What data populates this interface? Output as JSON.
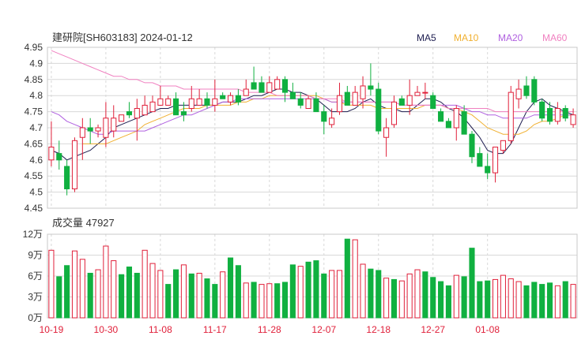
{
  "chart_data": [
    {
      "type": "candlestick",
      "title": "建研院[SH603183] 2024-01-12",
      "legend": [
        {
          "name": "MA5",
          "color": "#1e1e50"
        },
        {
          "name": "MA10",
          "color": "#f0b030"
        },
        {
          "name": "MA20",
          "color": "#b060e0"
        },
        {
          "name": "MA60",
          "color": "#f080c0"
        }
      ],
      "colors": {
        "up": "#e0203a",
        "down": "#10b040",
        "grid": "#d8d8d8"
      },
      "ylim": [
        4.45,
        4.95
      ],
      "y_ticks": [
        "4.95",
        "4.9",
        "4.85",
        "4.8",
        "4.75",
        "4.7",
        "4.65",
        "4.6",
        "4.55",
        "4.5",
        "4.45"
      ],
      "x_ticks": [
        "10-19",
        "10-30",
        "11-08",
        "11-17",
        "11-28",
        "12-07",
        "12-18",
        "12-27",
        "01-08"
      ],
      "x_tick_index": [
        0,
        7,
        14,
        21,
        28,
        35,
        42,
        49,
        56
      ],
      "candles": [
        [
          4.6,
          4.64,
          4.58,
          4.72
        ],
        [
          4.62,
          4.6,
          4.57,
          4.66
        ],
        [
          4.58,
          4.51,
          4.49,
          4.6
        ],
        [
          4.51,
          4.66,
          4.5,
          4.67
        ],
        [
          4.67,
          4.7,
          4.6,
          4.73
        ],
        [
          4.7,
          4.69,
          4.65,
          4.73
        ],
        [
          4.69,
          4.7,
          4.67,
          4.71
        ],
        [
          4.67,
          4.73,
          4.64,
          4.78
        ],
        [
          4.69,
          4.73,
          4.67,
          4.77
        ],
        [
          4.72,
          4.74,
          4.72,
          4.74
        ],
        [
          4.75,
          4.74,
          4.73,
          4.78
        ],
        [
          4.73,
          4.76,
          4.66,
          4.79
        ],
        [
          4.74,
          4.77,
          4.74,
          4.8
        ],
        [
          4.75,
          4.78,
          4.75,
          4.8
        ],
        [
          4.77,
          4.79,
          4.78,
          4.83
        ],
        [
          4.77,
          4.79,
          4.77,
          4.8
        ],
        [
          4.79,
          4.74,
          4.74,
          4.81
        ],
        [
          4.75,
          4.74,
          4.72,
          4.78
        ],
        [
          4.76,
          4.79,
          4.75,
          4.83
        ],
        [
          4.77,
          4.79,
          4.77,
          4.82
        ],
        [
          4.79,
          4.77,
          4.76,
          4.81
        ],
        [
          4.77,
          4.79,
          4.75,
          4.85
        ],
        [
          4.8,
          4.79,
          4.79,
          4.81
        ],
        [
          4.78,
          4.8,
          4.77,
          4.81
        ],
        [
          4.8,
          4.78,
          4.77,
          4.82
        ],
        [
          4.8,
          4.82,
          4.8,
          4.85
        ],
        [
          4.84,
          4.82,
          4.82,
          4.89
        ],
        [
          4.84,
          4.81,
          4.81,
          4.86
        ],
        [
          4.81,
          4.84,
          4.81,
          4.86
        ],
        [
          4.82,
          4.85,
          4.82,
          4.86
        ],
        [
          4.85,
          4.81,
          4.78,
          4.86
        ],
        [
          4.81,
          4.79,
          4.79,
          4.84
        ],
        [
          4.79,
          4.77,
          4.76,
          4.81
        ],
        [
          4.76,
          4.79,
          4.76,
          4.8
        ],
        [
          4.79,
          4.75,
          4.75,
          4.81
        ],
        [
          4.75,
          4.72,
          4.68,
          4.77
        ],
        [
          4.71,
          4.73,
          4.7,
          4.76
        ],
        [
          4.75,
          4.8,
          4.74,
          4.84
        ],
        [
          4.81,
          4.77,
          4.77,
          4.83
        ],
        [
          4.77,
          4.81,
          4.77,
          4.83
        ],
        [
          4.79,
          4.83,
          4.76,
          4.86
        ],
        [
          4.83,
          4.82,
          4.8,
          4.9
        ],
        [
          4.82,
          4.69,
          4.68,
          4.84
        ],
        [
          4.67,
          4.7,
          4.61,
          4.73
        ],
        [
          4.71,
          4.78,
          4.7,
          4.8
        ],
        [
          4.79,
          4.77,
          4.77,
          4.8
        ],
        [
          4.77,
          4.8,
          4.74,
          4.85
        ],
        [
          4.8,
          4.81,
          4.8,
          4.83
        ],
        [
          4.81,
          4.81,
          4.79,
          4.84
        ],
        [
          4.8,
          4.76,
          4.76,
          4.81
        ],
        [
          4.75,
          4.72,
          4.72,
          4.76
        ],
        [
          4.72,
          4.7,
          4.7,
          4.73
        ],
        [
          4.7,
          4.76,
          4.66,
          4.77
        ],
        [
          4.75,
          4.68,
          4.68,
          4.77
        ],
        [
          4.68,
          4.61,
          4.59,
          4.69
        ],
        [
          4.62,
          4.58,
          4.58,
          4.64
        ],
        [
          4.58,
          4.56,
          4.54,
          4.62
        ],
        [
          4.56,
          4.64,
          4.53,
          4.64
        ],
        [
          4.63,
          4.66,
          4.62,
          4.66
        ],
        [
          4.66,
          4.81,
          4.65,
          4.83
        ],
        [
          4.79,
          4.82,
          4.76,
          4.85
        ],
        [
          4.83,
          4.8,
          4.79,
          4.86
        ],
        [
          4.85,
          4.78,
          4.77,
          4.86
        ],
        [
          4.78,
          4.73,
          4.72,
          4.79
        ],
        [
          4.76,
          4.72,
          4.71,
          4.78
        ],
        [
          4.72,
          4.76,
          4.71,
          4.78
        ],
        [
          4.76,
          4.73,
          4.72,
          4.77
        ],
        [
          4.71,
          4.74,
          4.7,
          4.76
        ]
      ],
      "ma5": [
        4.63,
        4.62,
        4.6,
        4.61,
        4.62,
        4.63,
        4.65,
        4.67,
        4.7,
        4.71,
        4.72,
        4.73,
        4.74,
        4.75,
        4.76,
        4.76,
        4.77,
        4.77,
        4.77,
        4.77,
        4.77,
        4.77,
        4.78,
        4.78,
        4.78,
        4.79,
        4.8,
        4.8,
        4.81,
        4.82,
        4.82,
        4.81,
        4.81,
        4.8,
        4.79,
        4.77,
        4.75,
        4.75,
        4.75,
        4.76,
        4.78,
        4.79,
        4.77,
        4.76,
        4.76,
        4.75,
        4.75,
        4.77,
        4.79,
        4.79,
        4.78,
        4.76,
        4.75,
        4.73,
        4.7,
        4.67,
        4.63,
        4.62,
        4.62,
        4.65,
        4.7,
        4.75,
        4.78,
        4.79,
        4.77,
        4.76,
        4.75,
        4.74
      ],
      "ma10": [
        null,
        null,
        null,
        null,
        4.65,
        4.65,
        4.65,
        4.65,
        4.66,
        4.67,
        4.68,
        4.69,
        4.71,
        4.72,
        4.73,
        4.74,
        4.75,
        4.76,
        4.76,
        4.76,
        4.77,
        4.77,
        4.77,
        4.77,
        4.78,
        4.78,
        4.79,
        4.79,
        4.8,
        4.8,
        4.8,
        4.8,
        4.8,
        4.8,
        4.8,
        4.79,
        4.78,
        4.78,
        4.77,
        4.77,
        4.77,
        4.77,
        4.76,
        4.76,
        4.76,
        4.76,
        4.76,
        4.76,
        4.77,
        4.77,
        4.77,
        4.76,
        4.76,
        4.75,
        4.74,
        4.72,
        4.7,
        4.69,
        4.68,
        4.68,
        4.68,
        4.69,
        4.71,
        4.72,
        4.72,
        4.73,
        4.74,
        4.74
      ],
      "ma20": [
        4.75,
        4.74,
        4.72,
        4.71,
        4.7,
        4.69,
        4.68,
        4.68,
        4.69,
        4.69,
        4.69,
        4.69,
        4.69,
        4.7,
        4.71,
        4.72,
        4.73,
        4.74,
        4.74,
        4.75,
        4.76,
        4.77,
        4.78,
        4.78,
        4.79,
        4.79,
        4.79,
        4.79,
        4.79,
        4.79,
        4.79,
        4.79,
        4.79,
        4.79,
        4.79,
        4.79,
        4.78,
        4.78,
        4.78,
        4.78,
        4.78,
        4.78,
        4.78,
        4.78,
        4.78,
        4.77,
        4.77,
        4.77,
        4.77,
        4.77,
        4.77,
        4.77,
        4.77,
        4.76,
        4.75,
        4.75,
        4.74,
        4.74,
        4.73,
        4.73,
        4.73,
        4.73,
        4.74,
        4.74,
        4.74,
        4.74,
        4.74,
        4.74
      ],
      "ma60": [
        4.94,
        4.93,
        4.92,
        4.91,
        4.9,
        4.89,
        4.88,
        4.87,
        4.86,
        4.86,
        4.85,
        4.85,
        4.84,
        4.84,
        4.83,
        4.83,
        4.83,
        4.82,
        4.82,
        4.82,
        4.82,
        4.82,
        4.82,
        4.82,
        4.82,
        4.81,
        4.81,
        4.81,
        4.81,
        4.8,
        4.8,
        4.8,
        4.8,
        4.8,
        4.79,
        4.79,
        4.79,
        4.79,
        4.78,
        4.78,
        4.78,
        4.78,
        4.78,
        4.78,
        4.78,
        4.77,
        4.77,
        4.77,
        4.77,
        4.77,
        4.77,
        4.76,
        4.76,
        4.76,
        4.76,
        4.76,
        4.76,
        4.75,
        4.75,
        4.75,
        4.75,
        4.75,
        4.75,
        4.75,
        4.75,
        4.75,
        4.75,
        4.75
      ]
    },
    {
      "type": "bar",
      "title": "成交量 47927",
      "ylim": [
        0,
        120000
      ],
      "y_ticks": [
        "12万",
        "9万",
        "6万",
        "3万",
        "0万"
      ],
      "y_tick_values": [
        120000,
        90000,
        60000,
        30000,
        0
      ],
      "values": [
        97000,
        59000,
        75000,
        96000,
        84000,
        64000,
        69000,
        103000,
        82000,
        62000,
        73000,
        64000,
        97000,
        78000,
        68000,
        48000,
        69000,
        76000,
        63000,
        64000,
        56000,
        48000,
        66000,
        86000,
        75000,
        50000,
        51000,
        48000,
        49000,
        49000,
        51000,
        76000,
        74000,
        80000,
        82000,
        63000,
        68000,
        68000,
        113000,
        112000,
        77000,
        70000,
        68000,
        57000,
        55000,
        53000,
        63000,
        69000,
        66000,
        58000,
        52000,
        46000,
        61000,
        59000,
        100000,
        52000,
        53000,
        55000,
        61000,
        56000,
        52000,
        46000,
        51000,
        48000,
        50000,
        46000,
        52000,
        48000
      ],
      "up": [
        true,
        false,
        false,
        true,
        true,
        false,
        true,
        true,
        true,
        false,
        false,
        false,
        true,
        true,
        true,
        false,
        false,
        true,
        false,
        true,
        false,
        false,
        true,
        false,
        false,
        true,
        false,
        true,
        true,
        false,
        false,
        false,
        true,
        false,
        false,
        false,
        true,
        true,
        false,
        true,
        true,
        false,
        false,
        true,
        false,
        true,
        true,
        true,
        false,
        false,
        false,
        false,
        true,
        false,
        false,
        false,
        false,
        true,
        true,
        true,
        true,
        false,
        false,
        false,
        false,
        true,
        false,
        true
      ]
    }
  ]
}
